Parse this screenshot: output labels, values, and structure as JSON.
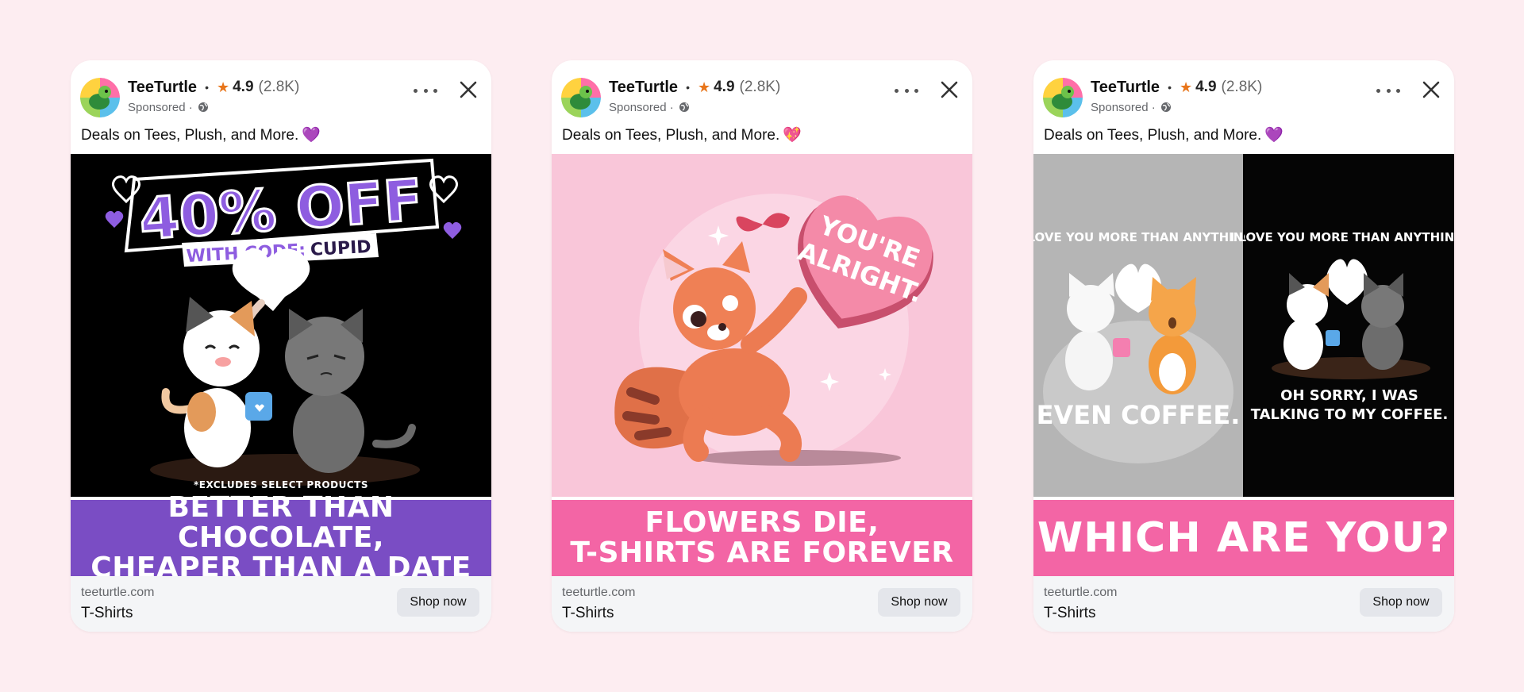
{
  "colors": {
    "page_bg": "#fdedf1",
    "card_bg": "#ffffff",
    "footer_bg": "#f4f5f7",
    "shop_button_bg": "#e4e6eb",
    "star": "#e8751a",
    "banner_purple": "#7a4dc4",
    "banner_pink": "#f365a5"
  },
  "ads": [
    {
      "brand": "TeeTurtle",
      "rating": "4.9",
      "rating_count": "(2.8K)",
      "sponsored": "Sponsored",
      "caption": "Deals on Tees, Plush, and More.",
      "caption_emoji": "💜",
      "creative": {
        "headline": "40% OFF",
        "code_prefix": "WITH CODE:",
        "code": "CUPID",
        "fine_print": "*EXCLUDES SELECT PRODUCTS"
      },
      "banner_lines": [
        "BETTER THAN CHOCOLATE,",
        "CHEAPER THAN A DATE"
      ],
      "domain": "teeturtle.com",
      "title": "T-Shirts",
      "cta": "Shop now"
    },
    {
      "brand": "TeeTurtle",
      "rating": "4.9",
      "rating_count": "(2.8K)",
      "sponsored": "Sponsored",
      "caption": "Deals on Tees, Plush, and More.",
      "caption_emoji": "💖",
      "creative": {
        "heart_line1": "YOU'RE",
        "heart_line2": "ALRIGHT."
      },
      "banner_lines": [
        "FLOWERS DIE,",
        "T-SHIRTS ARE FOREVER"
      ],
      "domain": "teeturtle.com",
      "title": "T-Shirts",
      "cta": "Shop now"
    },
    {
      "brand": "TeeTurtle",
      "rating": "4.9",
      "rating_count": "(2.8K)",
      "sponsored": "Sponsored",
      "caption": "Deals on Tees, Plush, and More.",
      "caption_emoji": "💜",
      "creative": {
        "left_top": "I LOVE YOU MORE THAN ANYTHING.",
        "left_bottom": "EVEN COFFEE.",
        "right_top": "I LOVE YOU MORE THAN ANYTHING.",
        "right_bottom_1": "OH SORRY, I WAS",
        "right_bottom_2": "TALKING TO MY COFFEE."
      },
      "banner_lines": [
        "WHICH ARE YOU?"
      ],
      "domain": "teeturtle.com",
      "title": "T-Shirts",
      "cta": "Shop now"
    }
  ]
}
